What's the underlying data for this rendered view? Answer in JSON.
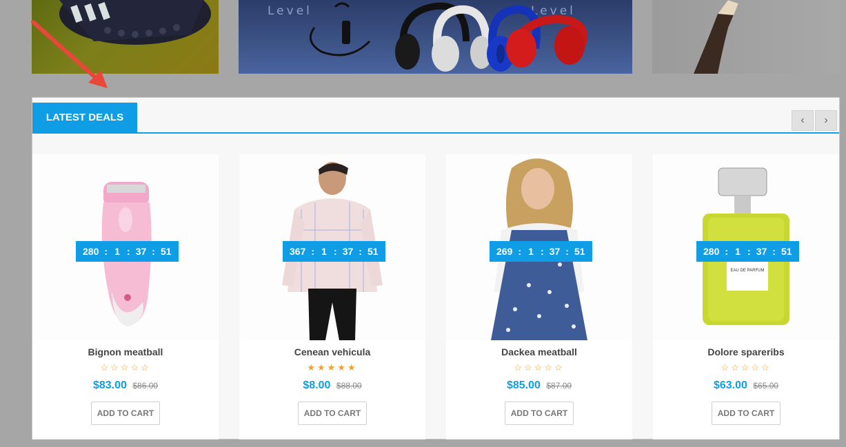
{
  "banner": {
    "brand_left": "Level",
    "brand_right": "Level"
  },
  "deals": {
    "title": "LATEST DEALS",
    "prev_icon": "chevron-left-icon",
    "next_icon": "chevron-right-icon",
    "prev_glyph": "‹",
    "next_glyph": "›"
  },
  "products": [
    {
      "name": "Bignon meatball",
      "countdown": {
        "days": "280",
        "hours": "1",
        "minutes": "37",
        "seconds": "51"
      },
      "rating": 0,
      "price": "$83.00",
      "old_price": "$86.00",
      "cart_label": "ADD TO CART"
    },
    {
      "name": "Cenean vehicula",
      "countdown": {
        "days": "367",
        "hours": "1",
        "minutes": "37",
        "seconds": "51"
      },
      "rating": 5,
      "price": "$8.00",
      "old_price": "$88.00",
      "cart_label": "ADD TO CART"
    },
    {
      "name": "Dackea meatball",
      "countdown": {
        "days": "269",
        "hours": "1",
        "minutes": "37",
        "seconds": "51"
      },
      "rating": 0,
      "price": "$85.00",
      "old_price": "$87.00",
      "cart_label": "ADD TO CART"
    },
    {
      "name": "Dolore spareribs",
      "countdown": {
        "days": "280",
        "hours": "1",
        "minutes": "37",
        "seconds": "51"
      },
      "rating": 0,
      "price": "$63.00",
      "old_price": "$65.00",
      "cart_label": "ADD TO CART"
    }
  ],
  "perfume_label": "EAU DE PARFUM",
  "colors": {
    "accent": "#0f9ee6",
    "star": "#f0a030",
    "arrow": "#e8473a"
  }
}
